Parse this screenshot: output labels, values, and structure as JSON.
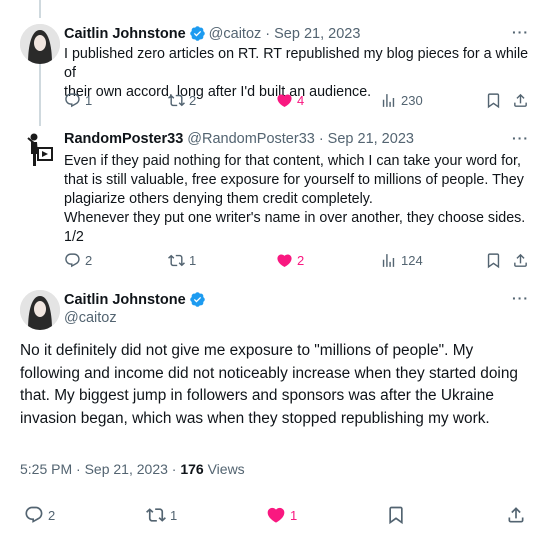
{
  "tweets": [
    {
      "name": "Caitlin Johnstone",
      "handle": "@caitoz",
      "date": "Sep 21, 2023",
      "text_lines": [
        "I published zero articles on RT. RT republished my blog pieces for a while of",
        "their own accord, long after I'd built an audience."
      ],
      "replies": "1",
      "retweets": "2",
      "likes": "4",
      "views": "230"
    },
    {
      "name": "RandomPoster33",
      "handle": "@RandomPoster33",
      "date": "Sep 21, 2023",
      "text_lines": [
        "Even if they paid nothing for that content, which I can take your word for,",
        "that is still valuable, free exposure for yourself to millions of people. They",
        "plagiarize others denying them credit completely.",
        "Whenever they put one writer's name in over another, they choose sides.",
        "1/2"
      ],
      "replies": "2",
      "retweets": "1",
      "likes": "2",
      "views": "124"
    }
  ],
  "main_tweet": {
    "name": "Caitlin Johnstone",
    "handle": "@caitoz",
    "text": "No it definitely did not give me exposure to \"millions of people\". My following and income did not noticeably increase when they started doing that. My biggest jump in followers and sponsors was after the Ukraine invasion began, which was when they stopped republishing my work.",
    "time": "5:25 PM",
    "date": "Sep 21, 2023",
    "views_count": "176",
    "views_label": "Views",
    "replies": "2",
    "retweets": "1",
    "likes": "1"
  },
  "more_label": "···",
  "separator": "·",
  "colors": {
    "like": "#f91880",
    "verified": "#1d9bf0",
    "muted": "#536471"
  },
  "icons": [
    "reply-icon",
    "retweet-icon",
    "like-icon",
    "views-icon",
    "bookmark-icon",
    "share-icon",
    "verified-icon"
  ]
}
